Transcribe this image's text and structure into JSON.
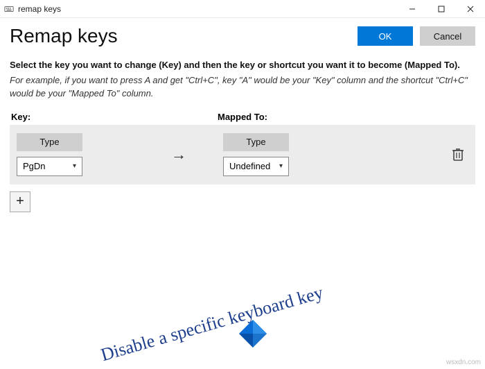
{
  "window": {
    "title": "remap keys"
  },
  "header": {
    "page_title": "Remap keys",
    "ok_label": "OK",
    "cancel_label": "Cancel"
  },
  "instruction": "Select the key you want to change (Key) and then the key or shortcut you want it to become (Mapped To).",
  "example": "For example, if you want to press A and get \"Ctrl+C\", key \"A\" would be your \"Key\" column and the shortcut \"Ctrl+C\" would be your \"Mapped To\" column.",
  "columns": {
    "key": "Key:",
    "mapped": "Mapped To:"
  },
  "row": {
    "type_label": "Type",
    "key_value": "PgDn",
    "mapped_value": "Undefined"
  },
  "overlay": {
    "text": "Disable a specific keyboard key"
  },
  "watermark": "wsxdn.com",
  "colors": {
    "primary": "#0078d7",
    "overlay_text": "#1d3f8c"
  }
}
